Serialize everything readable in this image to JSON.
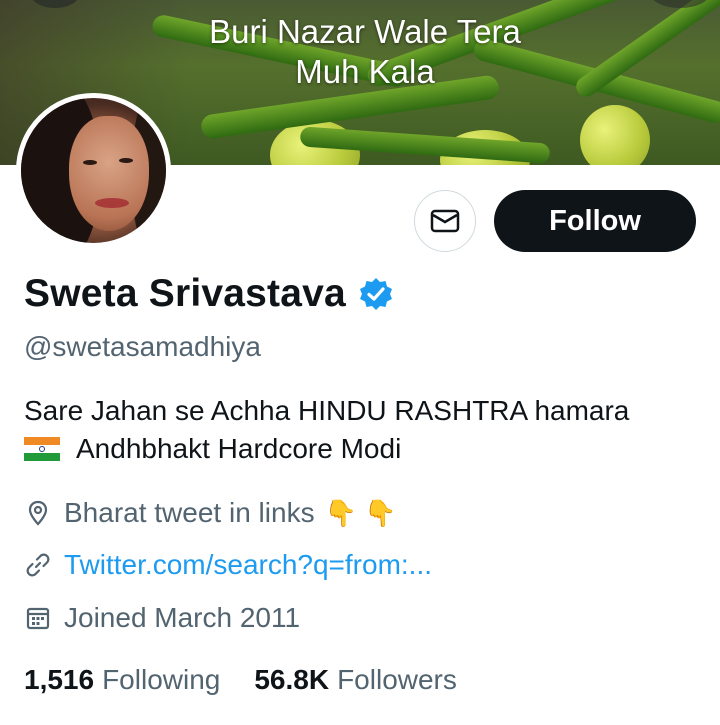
{
  "banner": {
    "line1": "Buri Nazar Wale Tera",
    "line2": "Muh Kala"
  },
  "actions": {
    "follow_label": "Follow"
  },
  "profile": {
    "name": "Sweta Srivastava",
    "handle": "@swetasamadhiya",
    "bio_line1": "Sare Jahan se Achha HINDU RASHTRA hamara",
    "bio_line2": "Andhbhakt  Hardcore Modi",
    "location": "Bharat  tweet in links",
    "location_emoji": "👇 👇",
    "website": "Twitter.com/search?q=from:...",
    "joined": "Joined March 2011"
  },
  "stats": {
    "following_count": "1,516",
    "following_label": "Following",
    "followers_count": "56.8K",
    "followers_label": "Followers"
  },
  "colors": {
    "accent": "#1d9bf0",
    "text": "#0f1419",
    "muted": "#536471",
    "button": "#0f1419"
  }
}
